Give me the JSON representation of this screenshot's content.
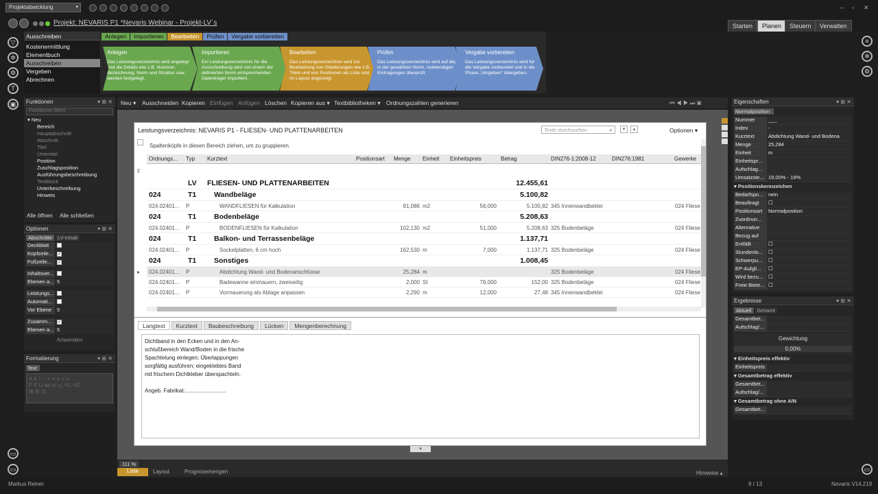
{
  "app": {
    "combo": "Projektabwicklung",
    "title": "Projekt: NEVARIS P1 *Nevaris Webinar - Projekt-LV´s",
    "winctl": [
      "‒",
      "▫",
      "✕"
    ]
  },
  "topTabs": [
    "Starten",
    "Planen",
    "Steuern",
    "Verwalten"
  ],
  "process": {
    "header": "Ausschreiben",
    "items": [
      "Kostenermittlung",
      "Elementbuch",
      "Ausschreiben",
      "Vergeben",
      "Abrechnen"
    ]
  },
  "ribbon": {
    "tabs": [
      "Anlegen",
      "Importieren",
      "Bearbeiten",
      "Prüfen",
      "Vergabe vorbereiten"
    ],
    "cards": [
      {
        "t": "Anlegen",
        "d": "Das Leistungsverzeichnis wird angelegt und die Details wie z.B. Nummer, Bezeichnung, Norm und Struktur usw. werden festgelegt.",
        "color": "#6aa84f"
      },
      {
        "t": "Importieren",
        "d": "Ein Leistungsverzeichnis für die Ausschreibung wird von einem der definierten Norm entsprechenden Datenträger importiert.",
        "color": "#6aa84f"
      },
      {
        "t": "Bearbeiten",
        "d": "Das Leistungsverzeichnis wird zur Bearbeitung von Gliederungen wie z.B. Titeln und von Positionen als Liste und im Layout angezeigt.",
        "color": "#c8962e"
      },
      {
        "t": "Prüfen",
        "d": "Das Leistungsverzeichnis wird auf die, in der gewählten Norm, notwendigen Eintragungen überprüft.",
        "color": "#6d8fc9"
      },
      {
        "t": "Vergabe vorbereiten",
        "d": "Das Leistungsverzeichnis wird für die Vergabe vorbereitet und in die Phase „Vergeben“ übergeben.",
        "color": "#6d8fc9"
      }
    ]
  },
  "funktionen": {
    "header": "Funktionen",
    "filter": "Funktionen filtern",
    "root": "Neu",
    "items": [
      {
        "l": "Bereich",
        "on": true
      },
      {
        "l": "Hauptabschnitt",
        "on": false
      },
      {
        "l": "Abschnitt",
        "on": false
      },
      {
        "l": "Titel",
        "on": false
      },
      {
        "l": "Untertitel",
        "on": false
      },
      {
        "l": "Position",
        "on": true
      },
      {
        "l": "Zuschlagsposition",
        "on": true
      },
      {
        "l": "Ausführungsbeschreibung",
        "on": true
      },
      {
        "l": "Textblock",
        "on": false
      },
      {
        "l": "Unterbeschreibung",
        "on": true
      },
      {
        "l": "Hinweis",
        "on": true
      }
    ],
    "open": "Alle öffnen",
    "close": "Alle schließen"
  },
  "optionen": {
    "header": "Optionen",
    "tabs": [
      "Abschnitte",
      "LV-Inhalt"
    ],
    "rows": [
      {
        "k": "Deckblatt",
        "v": ""
      },
      {
        "k": "Kopfzeile...",
        "v": "✓"
      },
      {
        "k": "Fußzeile...",
        "v": "✓"
      },
      {
        "k": "Inhaltsver...",
        "v": ""
      },
      {
        "k": "Ebenen a...",
        "v": "5"
      },
      {
        "k": "Leistungs...",
        "v": ""
      },
      {
        "k": "Automati...",
        "v": ""
      },
      {
        "k": "Vor Ebene",
        "v": "5"
      },
      {
        "k": "Zusamm...",
        "v": "✓"
      },
      {
        "k": "Ebenen a...",
        "v": "5"
      }
    ],
    "apply": "Anwenden"
  },
  "format": {
    "header": "Formatierung",
    "tab": "Text"
  },
  "toolbar": {
    "items": [
      "Neu ▾",
      "Ausschneiden",
      "Kopieren",
      "Einfügen",
      "Anfügen",
      "Löschen",
      "Kopieren aus ▾",
      "Textbibliotheken ▾",
      "Ordnungszahlen generieren"
    ]
  },
  "lv": {
    "title": "Leistungsverzeichnis: NEVARIS P1 - FLIESEN- UND PLATTENARBEITEN",
    "search": "Texte durchsuchen",
    "options": "Optionen ▾",
    "group": "Spaltenköpfe in diesen Bereich ziehen, um zu gruppieren.",
    "cols": [
      "Ordnungs...",
      "Typ",
      "Kurztext",
      "Positionsart",
      "Menge",
      "Einheit",
      "Einheitspreis",
      "Betrag",
      "DIN276-1:2008-12",
      "DIN276:1981",
      "Gewerke"
    ],
    "rows": [
      {
        "big": true,
        "oz": "",
        "typ": "LV",
        "kt": "FLIESEN- UND PLATTENARBEITEN",
        "m": "",
        "e": "",
        "ep": "",
        "b": "12.455,61",
        "din": "",
        "gw": ""
      },
      {
        "big": true,
        "oz": "024",
        "typ": "T1",
        "kt": "Wandbeläge",
        "m": "",
        "e": "",
        "ep": "",
        "b": "5.100,82",
        "din": "",
        "gw": ""
      },
      {
        "big": false,
        "oz": "024.02401...",
        "typ": "P",
        "kt": "WANDFLIESEN für Kalkulation",
        "m": "91,086",
        "e": "m2",
        "ep": "56,000",
        "b": "5.100,82",
        "din": "345 Innenwandbeklei",
        "gw": "024 Fliese"
      },
      {
        "big": true,
        "oz": "024",
        "typ": "T1",
        "kt": "Bodenbeläge",
        "m": "",
        "e": "",
        "ep": "",
        "b": "5.208,63",
        "din": "",
        "gw": ""
      },
      {
        "big": false,
        "oz": "024.02401...",
        "typ": "P",
        "kt": "BODENFLIESEN für Kalkulation",
        "m": "102,130",
        "e": "m2",
        "ep": "51,000",
        "b": "5.208,63",
        "din": "325 Bodenbeläge",
        "gw": "024 Fliese"
      },
      {
        "big": true,
        "oz": "024",
        "typ": "T1",
        "kt": "Balkon- und Terrassenbeläge",
        "m": "",
        "e": "",
        "ep": "",
        "b": "1.137,71",
        "din": "",
        "gw": ""
      },
      {
        "big": false,
        "oz": "024.02401...",
        "typ": "P",
        "kt": "Sockelplatten, 6 cm hoch",
        "m": "162,530",
        "e": "m",
        "ep": "7,000",
        "b": "1.137,71",
        "din": "325 Bodenbeläge",
        "gw": "024 Fliese"
      },
      {
        "big": true,
        "oz": "024",
        "typ": "T1",
        "kt": "Sonstiges",
        "m": "",
        "e": "",
        "ep": "",
        "b": "1.008,45",
        "din": "",
        "gw": ""
      },
      {
        "big": false,
        "sel": true,
        "oz": "024.02401...",
        "typ": "P",
        "kt": "Abdichtung Wand- und Bodenanschlüsse",
        "m": "25,284",
        "e": "m",
        "ep": "",
        "b": "",
        "din": "325 Bodenbeläge",
        "gw": "024 Fliese"
      },
      {
        "big": false,
        "oz": "024.02401...",
        "typ": "P",
        "kt": "Badewanne einmauern, zweiseitig",
        "m": "2,000",
        "e": "St",
        "ep": "76,000",
        "b": "152,00",
        "din": "325 Bodenbeläge",
        "gw": "024 Fliese"
      },
      {
        "big": false,
        "oz": "024.02401...",
        "typ": "P",
        "kt": "Vormauerung als Ablage anpassen",
        "m": "2,290",
        "e": "m",
        "ep": "12,000",
        "b": "27,48",
        "din": "345 Innenwandbeklei",
        "gw": "024 Fliese"
      }
    ],
    "bottomTabs": [
      "Langtext",
      "Kurztext",
      "Baubeschreibung",
      "Lücken",
      "Mengenberechnung"
    ],
    "langtext": [
      "Dichtband in den Ecken und in den An-",
      "schlußbereich Wand/Boden in die frische",
      "Spachtelung einlegen; Überlappungen",
      "sorgfältig ausführen; eingeklebtes Band",
      "mit frischem Dichtkleber überspachteln.",
      "",
      "Angeb. Fabrikat:..........................."
    ]
  },
  "eigenschaften": {
    "header": "Eigenschaften",
    "tab": "Normalposition",
    "rows": [
      {
        "k": "Nummer",
        "v": "___"
      },
      {
        "k": "Index",
        "v": "-"
      },
      {
        "k": "Kurztext",
        "v": "Abdichtung Wand- und Bodena"
      },
      {
        "k": "Menge",
        "v": "25,284"
      },
      {
        "k": "Einheit",
        "v": "m"
      },
      {
        "k": "Einheitspr...",
        "v": ""
      },
      {
        "k": "Aufschlag...",
        "v": ""
      },
      {
        "k": "Umsatzste...",
        "v": "19,00% - 19%"
      }
    ],
    "sec": "Positionskennzeichen",
    "rows2": [
      {
        "k": "Bedarfspo...",
        "v": "nein"
      },
      {
        "k": "Beauftragt",
        "v": "☐"
      },
      {
        "k": "Positionsart",
        "v": "Normalposition"
      },
      {
        "k": "Zuordnun...",
        "v": ""
      },
      {
        "k": "Alternative",
        "v": ""
      },
      {
        "k": "Bezug auf",
        "v": ""
      },
      {
        "k": "Entfällt",
        "v": "☐"
      },
      {
        "k": "Stundenlo...",
        "v": "☐"
      },
      {
        "k": "Schwerpu...",
        "v": "☐"
      },
      {
        "k": "EP-Aufgli...",
        "v": "☐"
      },
      {
        "k": "Wird bezu...",
        "v": "☐"
      },
      {
        "k": "Freie Biete...",
        "v": "☐"
      }
    ]
  },
  "ergebnisse": {
    "header": "Ergebnisse",
    "tabs": [
      "Aktuell",
      "Gesamt"
    ],
    "r1": "Gesamtbet...",
    "r2": "Aufschlag/...",
    "gew": "Gewichtung",
    "pct": "0,00%",
    "s1": "Einheitspreis effektiv",
    "s1r": "Einheitspreis",
    "s2": "Gesamtbetrag effektiv",
    "s2r1": "Gesamtbet...",
    "s2r2": "Aufschlag/...",
    "s3": "Gesamtbetrag ohne A/N",
    "s3r": "Gesamtbet..."
  },
  "bottom": {
    "zoom": "111 %",
    "views": [
      "Liste",
      "Layout",
      "Prognosemengen"
    ],
    "hinweise": "Hinweise ▴"
  },
  "status": {
    "user": "Markus Reiner",
    "page": "9 / 13",
    "version": "Nevaris V14.219"
  }
}
